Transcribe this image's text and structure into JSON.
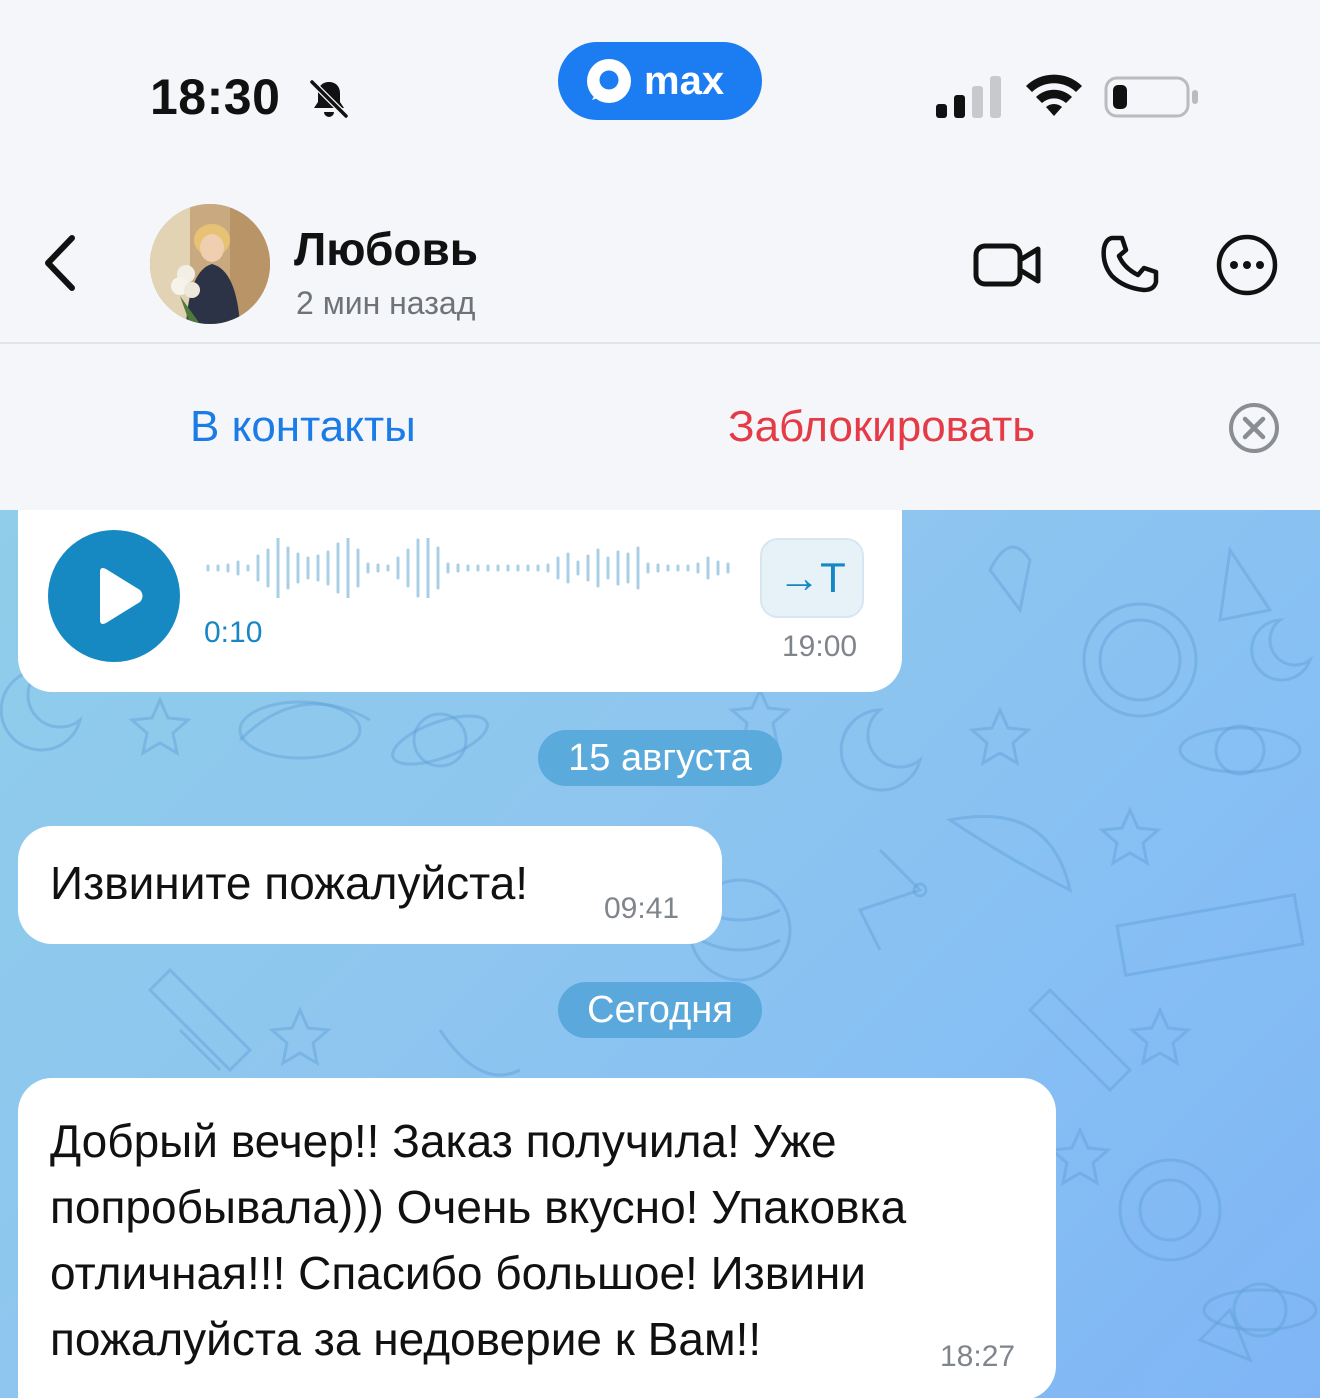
{
  "status_bar": {
    "time": "18:30",
    "app_badge": "max"
  },
  "header": {
    "contact_name": "Любовь",
    "last_seen": "2 мин назад"
  },
  "action_bar": {
    "add_contact": "В контакты",
    "block": "Заблокировать"
  },
  "chat": {
    "voice_message": {
      "duration": "0:10",
      "transcribe_label": "→T",
      "time": "19:00"
    },
    "date_separators": [
      "15 августа",
      "Сегодня"
    ],
    "messages": [
      {
        "text": "Извините пожалуйста!",
        "time": "09:41"
      },
      {
        "text": "Добрый вечер!! Заказ получила! Уже попробывала))) Очень вкусно! Упаковка отличная!!! Спасибо большое! Извини пожалуйста за недоверие к Вам!!",
        "time": "18:27"
      }
    ]
  },
  "colors": {
    "accent_blue": "#1b7ce8",
    "danger_red": "#e53b46",
    "max_brand": "#1c7cf2",
    "voice_accent": "#1689c2"
  },
  "icons": [
    "bell-muted-icon",
    "max-logo-icon",
    "signal-icon",
    "wifi-icon",
    "battery-icon",
    "back-icon",
    "video-call-icon",
    "phone-icon",
    "more-icon",
    "close-icon",
    "play-icon",
    "waveform"
  ]
}
